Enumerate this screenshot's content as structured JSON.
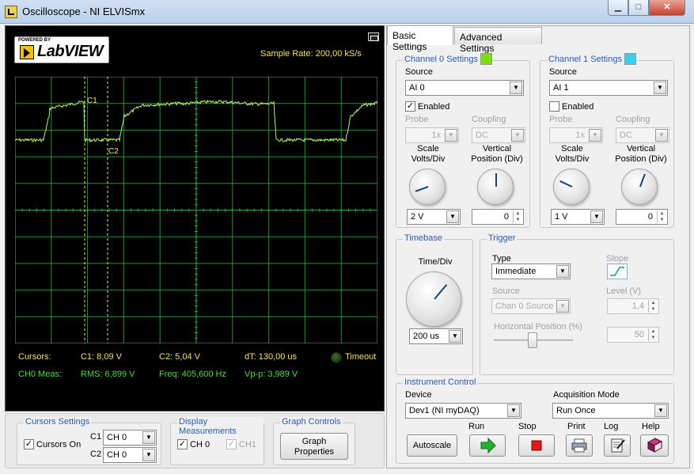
{
  "window": {
    "title": "Oscilloscope - NI ELVISmx",
    "min_glyph": "▁",
    "max_glyph": "□",
    "close_glyph": "✕"
  },
  "logo": {
    "powered": "POWERED BY",
    "text": "LabVIEW"
  },
  "display": {
    "sample_rate": "Sample Rate:  200,00 kS/s",
    "cursor_labels": {
      "c1": "C1",
      "c2": "C2"
    },
    "cursors_label": "Cursors:",
    "c1_value": "C1:  8,09 V",
    "c2_value": "C2:  5,04 V",
    "dt_value": "dT:  130,00 us",
    "timeout_label": "Timeout",
    "ch0_meas_label": "CH0 Meas:",
    "rms": "RMS:  6,899 V",
    "freq": "Freq:  405,600 Hz",
    "vpp": "Vp-p:  3,989 V",
    "trace_color": "#b6f56a",
    "grid_color": "#1fb33c"
  },
  "cursors_settings": {
    "title": "Cursors Settings",
    "cursors_on_label": "Cursors On",
    "cursors_on_checked": true,
    "c1_label": "C1",
    "c1_value": "CH 0",
    "c2_label": "C2",
    "c2_value": "CH 0"
  },
  "display_measurements": {
    "title": "Display Measurements",
    "ch0_label": "CH 0",
    "ch1_label": "CH1"
  },
  "graph_controls": {
    "title": "Graph Controls",
    "button_line1": "Graph",
    "button_line2": "Properties"
  },
  "tabs": {
    "basic": "Basic Settings",
    "advanced": "Advanced Settings"
  },
  "channel0": {
    "title": "Channel 0 Settings",
    "color": "#7ee000",
    "source_label": "Source",
    "source_value": "AI 0",
    "enabled_label": "Enabled",
    "enabled": true,
    "probe_label": "Probe",
    "probe_value": "1x",
    "coupling_label": "Coupling",
    "coupling_value": "DC",
    "scale_label_1": "Scale",
    "scale_label_2": "Volts/Div",
    "scale_value": "2 V",
    "vpos_label_1": "Vertical",
    "vpos_label_2": "Position (Div)",
    "vpos_value": "0"
  },
  "channel1": {
    "title": "Channel 1 Settings",
    "color": "#2fd2f0",
    "source_label": "Source",
    "source_value": "AI 1",
    "enabled_label": "Enabled",
    "enabled": false,
    "probe_label": "Probe",
    "probe_value": "1x",
    "coupling_label": "Coupling",
    "coupling_value": "DC",
    "scale_label_1": "Scale",
    "scale_label_2": "Volts/Div",
    "scale_value": "1 V",
    "vpos_label_1": "Vertical",
    "vpos_label_2": "Position (Div)",
    "vpos_value": "0"
  },
  "timebase": {
    "title": "Timebase",
    "label": "Time/Div",
    "value": "200 us"
  },
  "trigger": {
    "title": "Trigger",
    "type_label": "Type",
    "type_value": "Immediate",
    "slope_label": "Slope",
    "source_label": "Source",
    "source_value": "Chan 0 Source",
    "level_label": "Level (V)",
    "level_value": "1,4",
    "hpos_label": "Horizontal Position (%)",
    "hpos_value": "50"
  },
  "instrument_control": {
    "title": "Instrument Control",
    "device_label": "Device",
    "device_value": "Dev1 (NI myDAQ)",
    "acq_label": "Acquisition Mode",
    "acq_value": "Run Once",
    "autoscale": "Autoscale",
    "run_label": "Run",
    "stop_label": "Stop",
    "print_label": "Print",
    "log_label": "Log",
    "help_label": "Help"
  }
}
